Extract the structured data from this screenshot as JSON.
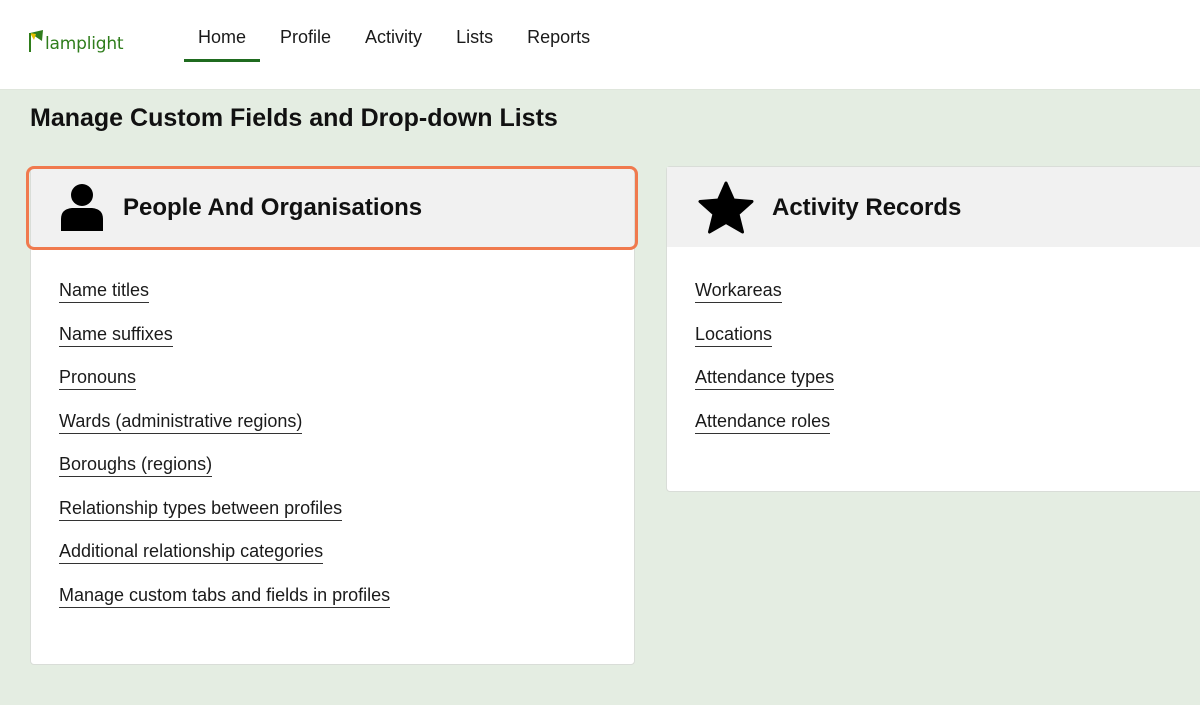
{
  "brand": {
    "name": "lamplight",
    "color": "#2f7d1c"
  },
  "nav": {
    "items": [
      {
        "label": "Home",
        "active": true
      },
      {
        "label": "Profile",
        "active": false
      },
      {
        "label": "Activity",
        "active": false
      },
      {
        "label": "Lists",
        "active": false
      },
      {
        "label": "Reports",
        "active": false
      }
    ]
  },
  "page": {
    "title": "Manage Custom Fields and Drop-down Lists"
  },
  "people": {
    "icon": "person-icon",
    "title": "People And Organisations",
    "links": [
      "Name titles",
      "Name suffixes",
      "Pronouns",
      "Wards (administrative regions)",
      "Boroughs (regions)",
      "Relationship types between profiles",
      "Additional relationship categories",
      "Manage custom tabs and fields in profiles"
    ]
  },
  "activity": {
    "icon": "star-icon",
    "title": "Activity Records",
    "links": [
      "Workareas",
      "Locations",
      "Attendance types",
      "Attendance roles"
    ]
  },
  "colors": {
    "highlight": "#f07a4e",
    "active_nav": "#1f6b1f",
    "background": "#e4ede2"
  }
}
